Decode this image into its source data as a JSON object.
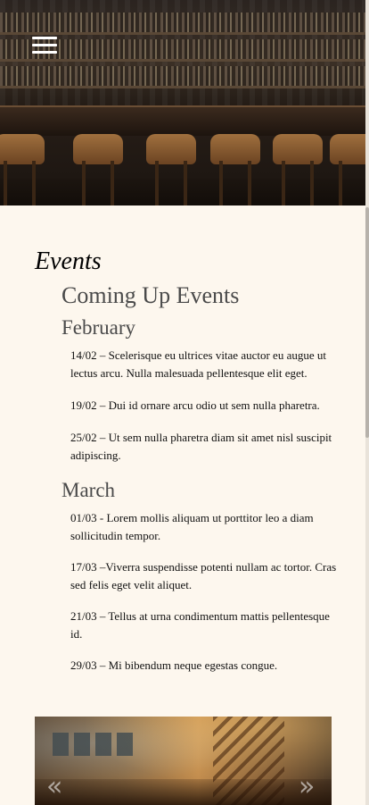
{
  "header": {
    "menu_icon": "hamburger-menu-icon"
  },
  "events": {
    "title": "Events",
    "subtitle": "Coming Up Events",
    "months": [
      {
        "name": "February",
        "items": [
          "14/02 – Scelerisque eu ultrices vitae auctor eu augue ut lectus arcu. Nulla malesuada pellentesque elit eget.",
          "19/02 – Dui id ornare arcu odio ut sem nulla pharetra.",
          "25/02 – Ut sem nulla pharetra diam sit amet nisl suscipit adipiscing."
        ]
      },
      {
        "name": "March",
        "items": [
          "01/03 - Lorem mollis aliquam ut porttitor leo a diam sollicitudin tempor.",
          "17/03 –Viverra suspendisse potenti nullam ac tortor. Cras sed felis eget velit aliquet.",
          "21/03 – Tellus at urna condimentum mattis pellentesque id.",
          "29/03 – Mi bibendum neque egestas congue."
        ]
      }
    ]
  },
  "gallery": {
    "prev_glyph": "«",
    "next_glyph": "»"
  },
  "colors": {
    "background": "#fdf7ee",
    "heading_gray": "#4a4a4a"
  }
}
